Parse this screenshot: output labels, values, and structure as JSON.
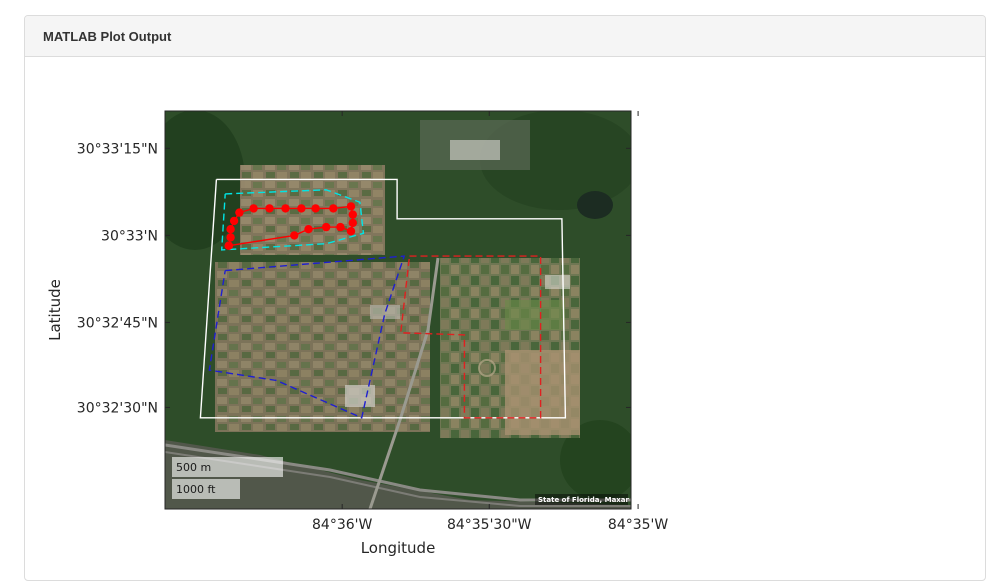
{
  "panel": {
    "title": "MATLAB Plot Output"
  },
  "chart_data": {
    "type": "scatter",
    "title": "",
    "xlabel": "Longitude",
    "ylabel": "Latitude",
    "basemap": "satellite",
    "grid": false,
    "xlim": [
      -84.61,
      -84.5837
    ],
    "ylim": [
      30.5368,
      30.556
    ],
    "x_ticks": [
      {
        "value": -84.6,
        "label": "84°36'W"
      },
      {
        "value": -84.5917,
        "label": "84°35'30\"W"
      },
      {
        "value": -84.5833,
        "label": "84°35'W"
      }
    ],
    "y_ticks": [
      {
        "value": 30.5542,
        "label": "30°33'15\"N"
      },
      {
        "value": 30.55,
        "label": "30°33'N"
      },
      {
        "value": 30.5458,
        "label": "30°32'45\"N"
      },
      {
        "value": 30.5417,
        "label": "30°32'30\"N"
      }
    ],
    "scalebar": {
      "metric": "500 m",
      "imperial": "1000 ft"
    },
    "attribution": "State of Florida, Maxar",
    "series": [
      {
        "type": "polygon",
        "style": "solid",
        "color": "#ffffff",
        "lon": [
          -84.6071,
          -84.5969,
          -84.5969,
          -84.5876,
          -84.5874,
          -84.608,
          -84.6071
        ],
        "lat": [
          30.5527,
          30.5527,
          30.5508,
          30.5508,
          30.5412,
          30.5412,
          30.5527
        ]
      },
      {
        "type": "polygon",
        "style": "dashed",
        "color": "#00e5e5",
        "lon": [
          -84.6066,
          -84.6009,
          -84.599,
          -84.5988,
          -84.6009,
          -84.6068,
          -84.6066
        ],
        "lat": [
          30.552,
          30.5522,
          30.5516,
          30.5501,
          30.5496,
          30.5493,
          30.552
        ]
      },
      {
        "type": "polygon",
        "style": "dashed",
        "color": "#1f1fd0",
        "lon": [
          -84.6066,
          -84.5965,
          -84.5976,
          -84.5989,
          -84.6037,
          -84.6075,
          -84.6066
        ],
        "lat": [
          30.5483,
          30.549,
          30.5462,
          30.5412,
          30.543,
          30.5435,
          30.5483
        ]
      },
      {
        "type": "polygon",
        "style": "dashed",
        "color": "#e02020",
        "lon": [
          -84.5962,
          -84.5888,
          -84.5888,
          -84.5931,
          -84.5931,
          -84.5967,
          -84.5962
        ],
        "lat": [
          30.549,
          30.549,
          30.5412,
          30.5412,
          30.5452,
          30.5453,
          30.549
        ]
      },
      {
        "type": "line",
        "style": "markers",
        "color": "#ff0000",
        "lon": [
          -84.6064,
          -84.6063,
          -84.6063,
          -84.6061,
          -84.6058,
          -84.605,
          -84.6041,
          -84.6032,
          -84.6023,
          -84.6015,
          -84.6005,
          -84.5995,
          -84.5994,
          -84.5994,
          -84.5995,
          -84.6001,
          -84.6009,
          -84.6019,
          -84.6027,
          -84.6064
        ],
        "lat": [
          30.5495,
          30.5499,
          30.5503,
          30.5507,
          30.5511,
          30.5513,
          30.5513,
          30.5513,
          30.5513,
          30.5513,
          30.5513,
          30.5514,
          30.551,
          30.5506,
          30.5502,
          30.5504,
          30.5504,
          30.5503,
          30.55,
          30.5495
        ]
      }
    ]
  }
}
